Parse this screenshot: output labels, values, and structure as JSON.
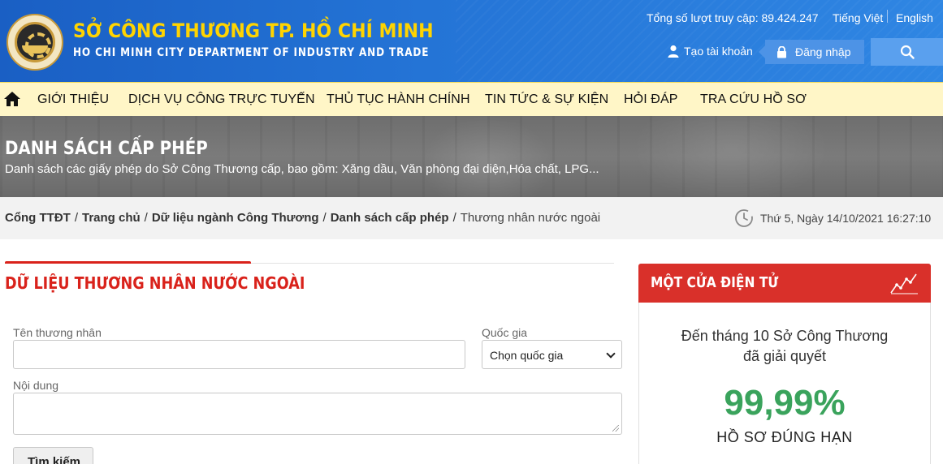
{
  "header": {
    "logo_icon": "department-seal-logo",
    "title": "SỞ CÔNG THƯƠNG TP. HỒ CHÍ MINH",
    "subtitle": "HO CHI MINH CITY DEPARTMENT OF INDUSTRY AND TRADE",
    "visit_counter": "Tổng số lượt truy cập: 89.424.247",
    "languages": [
      "Tiếng Việt",
      "English"
    ],
    "register_label": "Tạo tài khoản",
    "login_label": "Đăng nhập",
    "colors": {
      "brand_blue": "#2474d6",
      "title_yellow": "#ffd400"
    }
  },
  "nav": {
    "home_icon": "home-icon",
    "items": [
      "GIỚI THIỆU",
      "DỊCH VỤ CÔNG TRỰC TUYẾN",
      "THỦ TỤC HÀNH CHÍNH",
      "TIN TỨC & SỰ KIỆN",
      "HỎI ĐÁP",
      "TRA CỨU HỒ SƠ"
    ]
  },
  "banner": {
    "title": "DANH SÁCH CẤP PHÉP",
    "description": "Danh sách các giấy phép do Sở Công Thương cấp, bao gồm: Xăng dầu, Văn phòng đại diện,Hóa chất, LPG..."
  },
  "breadcrumb": {
    "items": [
      "Cổng TTĐT",
      "Trang chủ",
      "Dữ liệu ngành Công Thương",
      "Danh sách cấp phép"
    ],
    "current": "Thương nhân nước ngoài",
    "datetime": "Thứ 5, Ngày 14/10/2021 16:27:10"
  },
  "form": {
    "section_title": "DỮ LIỆU THƯƠNG NHÂN NƯỚC NGOÀI",
    "merchant_label": "Tên thương nhân",
    "merchant_value": "",
    "country_label": "Quốc gia",
    "country_selected": "Chọn quốc gia",
    "content_label": "Nội dung",
    "content_value": "",
    "search_button": "Tìm kiếm",
    "accent_color": "#d9221b"
  },
  "sidebar": {
    "title": "MỘT CỬA ĐIỆN TỬ",
    "icon": "trend-chart-icon",
    "line1": "Đến tháng 10 Sở Công Thương",
    "line2": "đã giải quyết",
    "percent": "99,99%",
    "caption": "HỒ SƠ ĐÚNG HẠN",
    "header_color": "#d9302a",
    "percent_color": "#3aa35c"
  }
}
